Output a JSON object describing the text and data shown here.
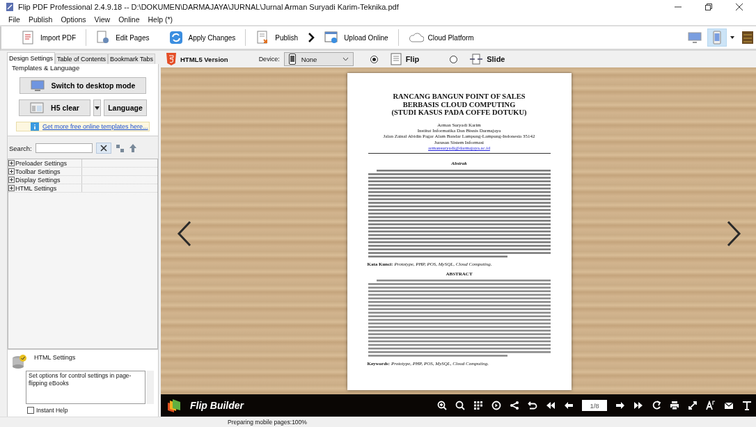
{
  "window": {
    "title": "Flip PDF Professional 2.4.9.18 -- D:\\DOKUMEN\\DARMAJAYA\\JURNAL\\Jurnal Arman Suryadi Karim-Teknika.pdf"
  },
  "menu": [
    "File",
    "Publish",
    "Options",
    "View",
    "Online",
    "Help (*)"
  ],
  "toolbar": [
    {
      "label": "Import PDF",
      "kind": "import"
    },
    {
      "label": "Edit Pages",
      "kind": "edit"
    },
    {
      "label": "Apply Changes",
      "kind": "apply"
    },
    {
      "label": "Publish",
      "kind": "publish"
    },
    {
      "label": "Upload Online",
      "kind": "upload"
    },
    {
      "label": "Cloud Platform",
      "kind": "cloud"
    }
  ],
  "view_modes": [
    {
      "kind": "desktop",
      "selected": false
    },
    {
      "kind": "mobile",
      "selected": true
    }
  ],
  "tabs": [
    {
      "label": "Design Settings",
      "selected": true
    },
    {
      "label": "Table of Contents",
      "selected": false
    },
    {
      "label": "Bookmark Tabs",
      "selected": false
    }
  ],
  "templates": {
    "heading": "Templates & Language",
    "desktop_button": "Switch to desktop mode",
    "template_button": "H5 clear",
    "language_button": "Language",
    "link": "Get more free online templates here..."
  },
  "search": {
    "label": "Search:"
  },
  "settings": [
    {
      "label": "Preloader Settings",
      "expanded": false
    },
    {
      "label": "Toolbar Settings",
      "expanded": false
    },
    {
      "label": "Display Settings",
      "expanded": false
    },
    {
      "label": "HTML Settings",
      "expanded": false
    }
  ],
  "help": {
    "title": "HTML Settings",
    "text": "Set options for control settings in page-flipping eBooks",
    "instant_help": {
      "label": "Instant Help",
      "checked": false
    }
  },
  "header": {
    "version": "HTML5 Version",
    "device_label": "Device:",
    "device": "None",
    "modes": [
      {
        "label": "Flip",
        "selected": true
      },
      {
        "label": "Slide",
        "selected": false
      }
    ]
  },
  "document": {
    "title": [
      "RANCANG BANGUN POINT OF SALES",
      "BERBASIS CLOUD COMPUTING",
      "(STUDI KASUS PADA COFFE DOTUKU)"
    ],
    "authors": [
      "Arman Suryadi Karim",
      "Institut Informatika Dan Bisnis Darmajaya",
      "Jalan Zainal Abidin Pagar Alam Bandar Lampung-Lampung-Indonesia 35142",
      "Jurusan Sistem Informasi"
    ],
    "email": "armansuryadi@darmajaya.ac.id",
    "abstract_heading": "Abstrak",
    "keywords": "**Kata Kunci:** *Prototype, PHP, POS, MySQL, Cloud Computing.*",
    "abstract_en_heading": "ABSTRACT",
    "keywords_en": "**Keywords:** *Prototype, PHP, POS, MySQL, Cloud Computing.*"
  },
  "viewer": {
    "brand": "Flip Builder",
    "page": "1/8"
  },
  "status_bar": "Preparing mobile pages:100%"
}
